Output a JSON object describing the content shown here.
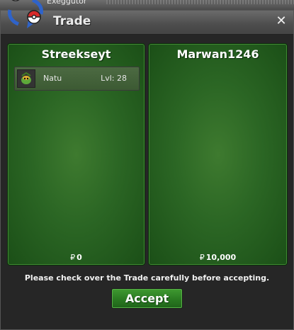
{
  "background": {
    "partial_text": "Exeggutor"
  },
  "window": {
    "title": "Trade",
    "close_label": "✕",
    "accent_color": "#2b6624"
  },
  "left_panel": {
    "player": "Streekseyt",
    "items": [
      {
        "icon": "pokemon-sprite-icon",
        "name": "Natu",
        "level": "Lvl: 28"
      }
    ],
    "money_symbol": "₽",
    "money": "0"
  },
  "right_panel": {
    "player": "Marwan1246",
    "items": [],
    "money_symbol": "₽",
    "money": "10,000"
  },
  "notice": "Please check over the Trade carefully before accepting.",
  "accept_label": "Accept"
}
